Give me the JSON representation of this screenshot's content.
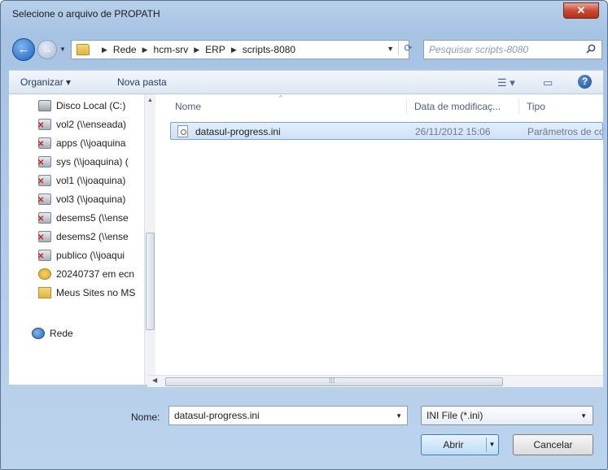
{
  "window": {
    "title": "Selecione o arquivo de PROPATH",
    "close_symbol": "✕"
  },
  "navigation": {
    "breadcrumbs": [
      "Rede",
      "hcm-srv",
      "ERP",
      "scripts-8080"
    ],
    "search_placeholder": "Pesquisar scripts-8080"
  },
  "toolbar": {
    "organize_label": "Organizar ▾",
    "new_folder_label": "Nova pasta",
    "help_symbol": "?"
  },
  "sidebar": {
    "items": [
      {
        "label": "Disco Local (C:)",
        "icon": "drive-icon"
      },
      {
        "label": "vol2 (\\\\enseada)",
        "icon": "network-drive-disconnected-icon"
      },
      {
        "label": "apps (\\\\joaquina",
        "icon": "network-drive-disconnected-icon"
      },
      {
        "label": "sys (\\\\joaquina) (",
        "icon": "network-drive-disconnected-icon"
      },
      {
        "label": "vol1 (\\\\joaquina)",
        "icon": "network-drive-disconnected-icon"
      },
      {
        "label": "vol3 (\\\\joaquina)",
        "icon": "network-drive-disconnected-icon"
      },
      {
        "label": "desems5 (\\\\ense",
        "icon": "network-drive-disconnected-icon"
      },
      {
        "label": "desems2 (\\\\ense",
        "icon": "network-drive-disconnected-icon"
      },
      {
        "label": "publico (\\\\joaqui",
        "icon": "network-drive-disconnected-icon"
      },
      {
        "label": "20240737 em ecn",
        "icon": "cloud-drive-icon"
      },
      {
        "label": "Meus Sites no MS",
        "icon": "folder-icon"
      }
    ],
    "network_label": "Rede"
  },
  "file_list": {
    "columns": [
      "Nome",
      "Data de modificaç...",
      "Tipo"
    ],
    "rows": [
      {
        "name": "datasul-progress.ini",
        "modified": "26/11/2012 15:06",
        "type": "Parâmetros de co"
      }
    ]
  },
  "footer": {
    "name_label": "Nome:",
    "filename_value": "datasul-progress.ini",
    "filter_value": "INI File (*.ini)",
    "open_label": "Abrir",
    "cancel_label": "Cancelar"
  }
}
